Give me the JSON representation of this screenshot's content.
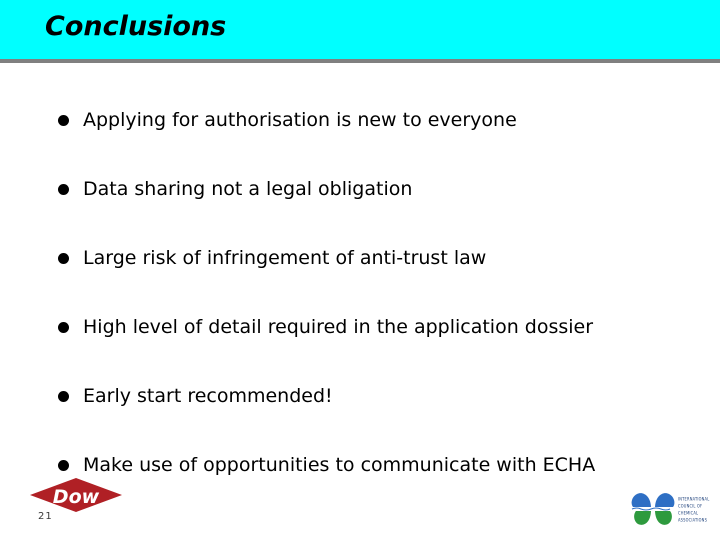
{
  "slide": {
    "title": "Conclusions",
    "title_band_color": "#00ffff",
    "divider_color": "#808080",
    "background_color": "#ffffff",
    "text_color": "#000000",
    "page_number": "21"
  },
  "bullets": [
    {
      "text": "Applying for authorisation is new to everyone"
    },
    {
      "text": "Data sharing not a legal obligation"
    },
    {
      "text": "Large risk of infringement of anti-trust law"
    },
    {
      "text": "High level of detail required in the application dossier"
    },
    {
      "text": "Early start recommended!"
    },
    {
      "text": "Make use of opportunities to communicate with ECHA"
    }
  ],
  "logos": {
    "dow": {
      "name": "dow-logo",
      "wordmark": "Dow",
      "trademark": "®",
      "color": "#b02025"
    },
    "icca": {
      "name": "icca-logo",
      "line1": "INTERNATIONAL",
      "line2": "COUNCIL OF",
      "line3": "CHEMICAL",
      "line4": "ASSOCIATIONS",
      "mark_top_color": "#2e6fc4",
      "mark_bottom_color": "#2e9a3e"
    }
  }
}
